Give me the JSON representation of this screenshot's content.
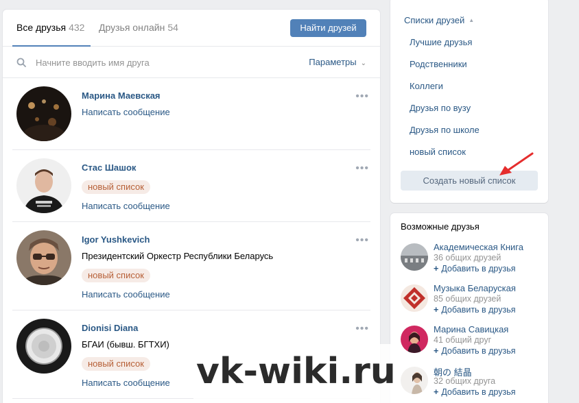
{
  "tabs": [
    {
      "label": "Все друзья",
      "count": "432"
    },
    {
      "label": "Друзья онлайн",
      "count": "54"
    }
  ],
  "find_friends_label": "Найти друзей",
  "search": {
    "placeholder": "Начните вводить имя друга",
    "value": ""
  },
  "params_label": "Параметры",
  "friends": [
    {
      "name": "Марина Маевская",
      "sub": "",
      "tag": "",
      "message": "Написать сообщение"
    },
    {
      "name": "Стас Шашок",
      "sub": "",
      "tag": "новый список",
      "message": "Написать сообщение"
    },
    {
      "name": "Igor Yushkevich",
      "sub": "Президентский Оркестр Республики Беларусь",
      "tag": "новый список",
      "message": "Написать сообщение"
    },
    {
      "name": "Dionisi Diana",
      "sub": "БГАИ (бывш. БГТХИ)",
      "tag": "новый список",
      "message": "Написать сообщение"
    }
  ],
  "more_glyph": "•••",
  "friend_lists": {
    "title": "Списки друзей",
    "items": [
      "Лучшие друзья",
      "Родственники",
      "Коллеги",
      "Друзья по вузу",
      "Друзья по школе",
      "новый список"
    ],
    "create_label": "Создать новый список"
  },
  "possible": {
    "title": "Возможные друзья",
    "add_label": "Добавить в друзья",
    "items": [
      {
        "name": "Академическая Книга",
        "mutual": "36 общих друзей"
      },
      {
        "name": "Музыка Беларуская",
        "mutual": "85 общих друзей"
      },
      {
        "name": "Марина Савицкая",
        "mutual": "41 общий друг"
      },
      {
        "name": "朝の 結晶",
        "mutual": "32 общих друга"
      }
    ]
  },
  "watermark": "vk-wiki.ru",
  "colors": {
    "accent": "#5181b8",
    "link": "#2a5885",
    "tag_bg": "#f6ebe6",
    "tag_text": "#b65f36",
    "arrow": "#e52d2d"
  }
}
